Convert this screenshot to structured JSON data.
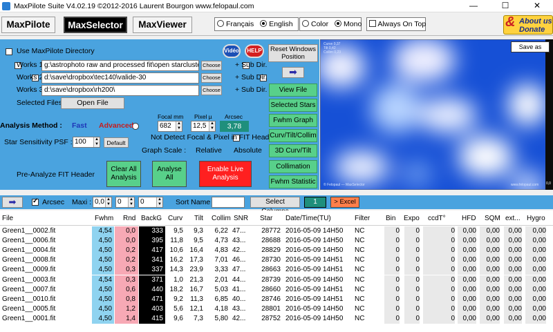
{
  "window": {
    "title": "MaxPilote Suite  V4.02.19  ©2012-2016 Laurent Bourgon  www.felopaul.com",
    "minimize": "—",
    "maximize": "☐",
    "close": "✕"
  },
  "tabs": [
    {
      "label": "MaxPilote",
      "active": false
    },
    {
      "label": "MaxSelector",
      "active": true
    },
    {
      "label": "MaxViewer",
      "active": false
    }
  ],
  "lang": {
    "fr": "Français",
    "en": "English",
    "selected": "English"
  },
  "colormode": {
    "color": "Color",
    "mono": "Mono",
    "selected": "Mono"
  },
  "always_on_top": "Always On Top",
  "donate": {
    "amp": "&",
    "line1": "About us",
    "line2": "Donate"
  },
  "dirs": {
    "use_maxpilote": "Use MaxPilote Directory",
    "video": "Vidéo",
    "help": "HELP",
    "reset_windows": "Reset Windows Position",
    "works": [
      {
        "label": "Works 1 :",
        "path": "g:\\astrophoto raw and processed fit\\open starcluster\\m",
        "choose": "Choose",
        "subdir": "+ Sub Dir."
      },
      {
        "label": "Works 2 :",
        "path": "d:\\save\\dropbox\\tec140\\valide-30",
        "choose": "Choose",
        "subdir": "+ Sub Dir."
      },
      {
        "label": "Works 3 :",
        "path": "d:\\save\\dropbox\\rh200\\",
        "choose": "Choose",
        "subdir": "+ Sub Dir."
      }
    ],
    "selected_files": "Selected Files :",
    "open_file": "Open File"
  },
  "analysis": {
    "method_label": "Analysis Method :",
    "fast": "Fast",
    "advanced": "Advanced",
    "focal_label": "Focal mm",
    "focal": "682",
    "pixel_label": "Pixel µ",
    "pixel": "12,5",
    "arcsec_label": "Arcsec",
    "arcsec": "3,78",
    "not_detect": "Not Detect Focal & Pixel in FIT Header",
    "star_sens": "Star Sensitivity  PSF :",
    "psf": "100",
    "default": "Default",
    "graph_scale": "Graph Scale :",
    "relative": "Relative",
    "absolute": "Absolute",
    "pre_analyze": "Pre-Analyze FIT Header",
    "clear_all": "Clear All Analysis",
    "analyse_all": "Analyse All",
    "enable_live": "Enable Live Analysis"
  },
  "right_buttons": [
    "View File",
    "Selected Stars",
    "Fwhm Graph",
    "Curv/Tilt/Collim",
    "3D Curv/Tilt",
    "Collimation",
    "Fwhm Statistic"
  ],
  "heatmap": {
    "save_as": "Save as",
    "brand": "www.felopaul.com",
    "tiny_top": [
      "Curve  0,37",
      "Tilt  0,42",
      "Collim  0,23"
    ],
    "tiny_bottom": "© Felopaul — MaxSelector",
    "axis_label": "0,0"
  },
  "toolbar2": {
    "arcsec": "Arcsec",
    "maxi": "Maxi :",
    "maxi_values": [
      "0,0",
      "0",
      "0"
    ],
    "sort_name": "Sort Name :",
    "sort_value": "",
    "select_columns": "Select Columns",
    "count": "1",
    "excel": "> Excel"
  },
  "table": {
    "headers": [
      "File",
      "Fwhm",
      "Rnd",
      "BackG",
      "Curv",
      "Tilt",
      "Collim",
      "SNR",
      "Star",
      "Date/Time(TU)",
      "Filter",
      "Bin",
      "Expo",
      "ccdT°",
      "HFD",
      "SQM",
      "ext...",
      "Hygro"
    ],
    "rows": [
      [
        "Green1__0002.fit",
        "4,54",
        "0,0",
        "333",
        "9,5",
        "9,3",
        "6,22",
        "47...",
        "28772",
        "2016-05-09 14H50",
        "NC",
        "0",
        "0",
        "0",
        "0,00",
        "0,00",
        "0,00",
        "0,00"
      ],
      [
        "Green1__0006.fit",
        "4,50",
        "0,0",
        "395",
        "11,8",
        "9,5",
        "4,73",
        "43...",
        "28688",
        "2016-05-09 14H50",
        "NC",
        "0",
        "0",
        "0",
        "0,00",
        "0,00",
        "0,00",
        "0,00"
      ],
      [
        "Green1__0004.fit",
        "4,50",
        "0,2",
        "417",
        "10,6",
        "16,4",
        "4,83",
        "42...",
        "28829",
        "2016-05-09 14H50",
        "NC",
        "0",
        "0",
        "0",
        "0,00",
        "0,00",
        "0,00",
        "0,00"
      ],
      [
        "Green1__0008.fit",
        "4,50",
        "0,2",
        "341",
        "16,2",
        "17,3",
        "7,01",
        "46...",
        "28730",
        "2016-05-09 14H51",
        "NC",
        "0",
        "0",
        "0",
        "0,00",
        "0,00",
        "0,00",
        "0,00"
      ],
      [
        "Green1__0009.fit",
        "4,50",
        "0,3",
        "337",
        "14,3",
        "23,9",
        "3,33",
        "47...",
        "28663",
        "2016-05-09 14H51",
        "NC",
        "0",
        "0",
        "0",
        "0,00",
        "0,00",
        "0,00",
        "0,00"
      ],
      [
        "Green1__0003.fit",
        "4,54",
        "0,3",
        "371",
        "1,0",
        "21,3",
        "2,01",
        "44...",
        "28739",
        "2016-05-09 14H50",
        "NC",
        "0",
        "0",
        "0",
        "0,00",
        "0,00",
        "0,00",
        "0,00"
      ],
      [
        "Green1__0007.fit",
        "4,50",
        "0,6",
        "440",
        "18,2",
        "16,7",
        "5,03",
        "41...",
        "28660",
        "2016-05-09 14H51",
        "NC",
        "0",
        "0",
        "0",
        "0,00",
        "0,00",
        "0,00",
        "0,00"
      ],
      [
        "Green1__0010.fit",
        "4,50",
        "0,8",
        "471",
        "9,2",
        "11,3",
        "6,85",
        "40...",
        "28746",
        "2016-05-09 14H51",
        "NC",
        "0",
        "0",
        "0",
        "0,00",
        "0,00",
        "0,00",
        "0,00"
      ],
      [
        "Green1__0005.fit",
        "4,50",
        "1,2",
        "403",
        "5,6",
        "12,1",
        "4,18",
        "43...",
        "28801",
        "2016-05-09 14H50",
        "NC",
        "0",
        "0",
        "0",
        "0,00",
        "0,00",
        "0,00",
        "0,00"
      ],
      [
        "Green1__0001.fit",
        "4,50",
        "1,4",
        "415",
        "9,6",
        "7,3",
        "5,80",
        "42...",
        "28752",
        "2016-05-09 14H50",
        "NC",
        "0",
        "0",
        "0",
        "0,00",
        "0,00",
        "0,00",
        "0,00"
      ]
    ]
  },
  "colors": {
    "panel": "#4aa3df",
    "fwhm_col": "#8fd3f0",
    "rnd_col": "#f7a9b5",
    "backg_col": "#000000",
    "enable_live": "#ff2020",
    "green_btn": "#58d08a",
    "heat_low": "#1650d6",
    "heat_high": "#f5f5ff"
  }
}
